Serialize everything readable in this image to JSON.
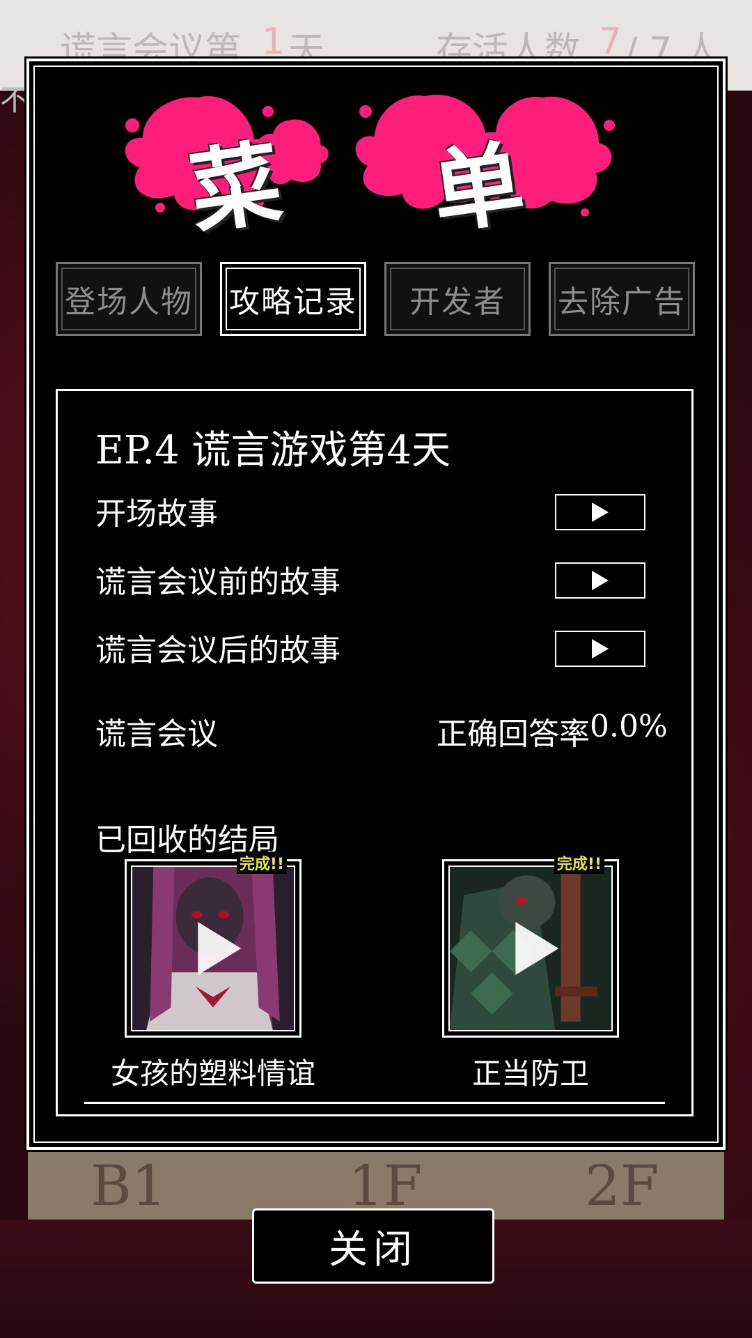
{
  "background": {
    "hud_left": "谎言会议第",
    "hud_day": "1",
    "hud_day_unit": "天",
    "hud_right": "存活人数",
    "hud_alive": "7",
    "hud_total": "/ 7 人",
    "side_label": "不知",
    "floors": [
      "B1",
      "1F",
      "2F"
    ]
  },
  "menu": {
    "title_chars": [
      "菜",
      "单"
    ],
    "splash_color": "#ff1f7a",
    "tabs": [
      {
        "label": "登场人物",
        "active": false
      },
      {
        "label": "攻略记录",
        "active": true
      },
      {
        "label": "开发者",
        "active": false
      },
      {
        "label": "去除广告",
        "active": false
      }
    ]
  },
  "record": {
    "episode_title": "EP.4  谎言游戏第4天",
    "stories": [
      {
        "label": "开场故事"
      },
      {
        "label": "谎言会议前的故事"
      },
      {
        "label": "谎言会议后的故事"
      }
    ],
    "meeting_label": "谎言会议",
    "accuracy_label": "正确回答率",
    "accuracy_value": "0.0%",
    "endings_title": "已回收的结局",
    "endings": [
      {
        "name": "女孩的塑料情谊",
        "badge": "完成!!"
      },
      {
        "name": "正当防卫",
        "badge": "完成!!"
      }
    ]
  },
  "close_label": "关闭"
}
